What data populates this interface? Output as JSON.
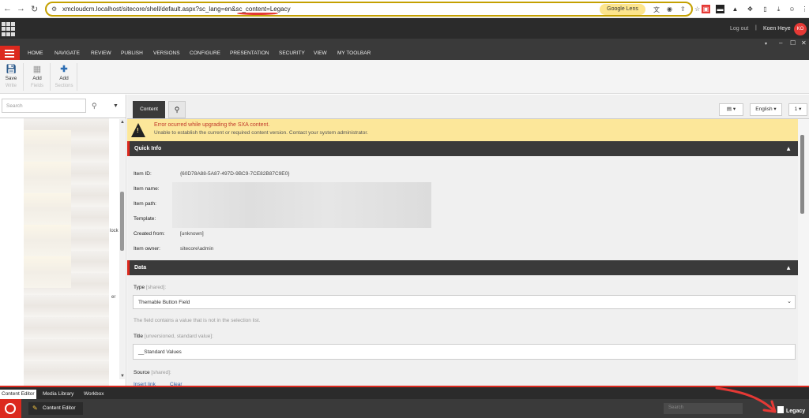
{
  "browser": {
    "back": "←",
    "forward": "→",
    "reload": "↻",
    "url": "xmcloudcm.localhost/sitecore/shell/default.aspx?sc_lang=en&sc_content=Legacy",
    "lens_label": "Google Lens"
  },
  "header": {
    "logout": "Log out",
    "separator": "|",
    "username": "Koen Heye",
    "avatar_initials": "KO"
  },
  "ribbon_tabs": [
    "HOME",
    "NAVIGATE",
    "REVIEW",
    "PUBLISH",
    "VERSIONS",
    "CONFIGURE",
    "PRESENTATION",
    "SECURITY",
    "VIEW",
    "MY TOOLBAR"
  ],
  "window_controls": [
    "▾",
    "–",
    "☐",
    "✕"
  ],
  "ribbon": {
    "save": {
      "label": "Save",
      "group": "Write"
    },
    "add_fields": {
      "label": "Add",
      "group": "Fields"
    },
    "add_sections": {
      "label": "Add",
      "group": "Sections"
    }
  },
  "tree": {
    "search_placeholder": "Search",
    "fragments": [
      "lock",
      "er"
    ]
  },
  "content": {
    "tab_content": "Content",
    "language": "English",
    "version": "1",
    "warning_title": "Error ocurred while upgrading the SXA content.",
    "warning_text": "Unable to establish the current or required content version. Contact your system administrator.",
    "quick_info": {
      "header": "Quick Info",
      "item_id_label": "Item ID:",
      "item_id": "{60D78A88-5A87-497D-9BC9-7CE82B87C9E0}",
      "item_name_label": "Item name:",
      "item_path_label": "Item path:",
      "template_label": "Template:",
      "created_from_label": "Created from:",
      "created_from": "[unknown]",
      "item_owner_label": "Item owner:",
      "item_owner": "sitecore\\admin"
    },
    "data": {
      "header": "Data",
      "type_label": "Type",
      "type_note": "[shared]:",
      "type_value": "Themable Button Field",
      "type_msg": "The field contains a value that is not in the selection list.",
      "title_label": "Title",
      "title_note": "[unversioned, standard value]:",
      "title_value": "__Standard Values",
      "source_label": "Source",
      "source_note": "[shared]:",
      "insert_link": "Insert link",
      "clear": "Clear"
    }
  },
  "bottom_tabs": [
    "Content Editor",
    "Media Library",
    "Workbox"
  ],
  "taskbar": {
    "item": "Content Editor",
    "search_placeholder": "Search",
    "legacy": "Legacy"
  },
  "colors": {
    "accent": "#dc291e",
    "dark": "#3a3a3a",
    "warning": "#fce79a"
  }
}
